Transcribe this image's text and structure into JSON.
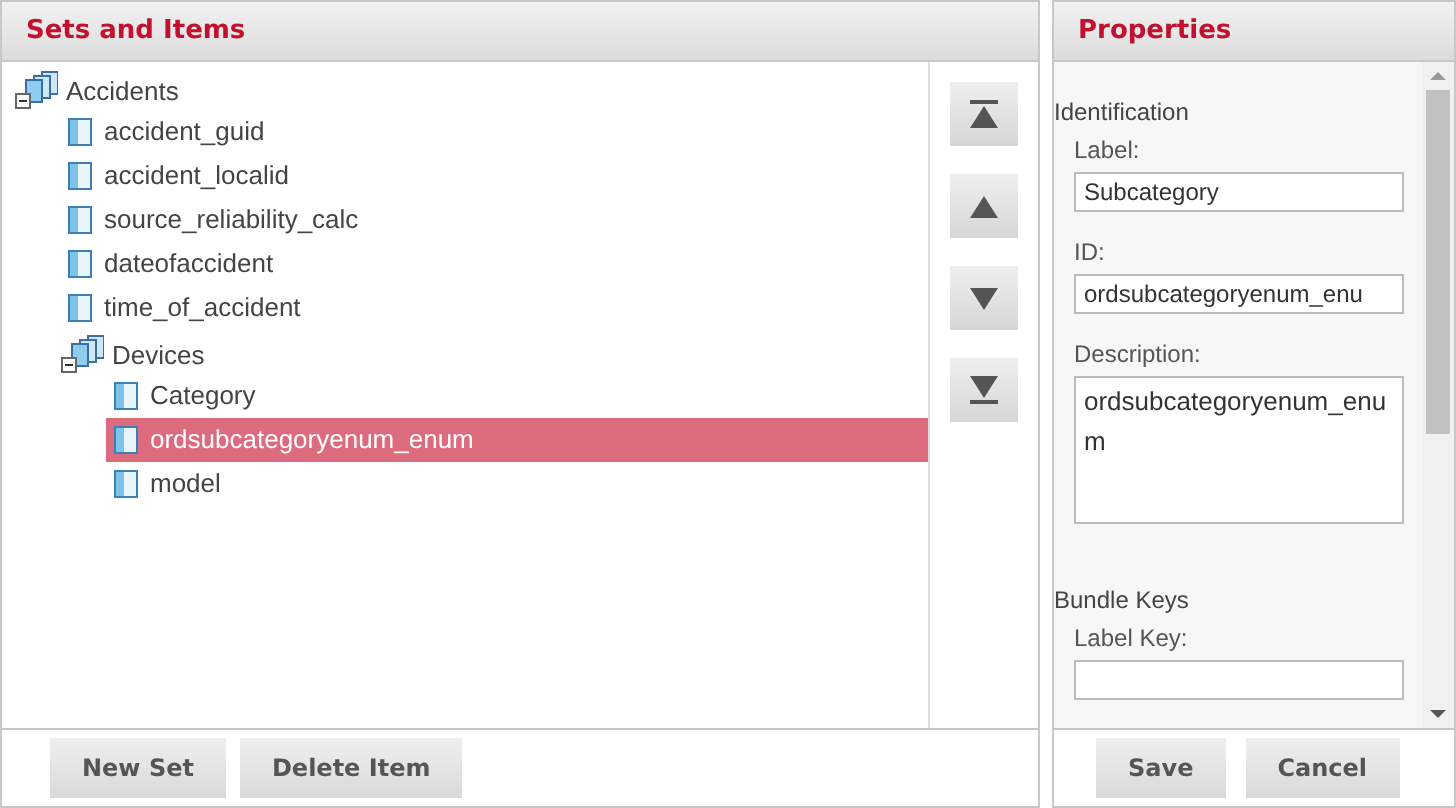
{
  "sets_panel": {
    "title": "Sets and Items",
    "tree": [
      {
        "kind": "set",
        "label": "Accidents",
        "expanded": true,
        "selected": false,
        "children": [
          {
            "kind": "item",
            "label": "accident_guid",
            "selected": false
          },
          {
            "kind": "item",
            "label": "accident_localid",
            "selected": false
          },
          {
            "kind": "item",
            "label": "source_reliability_calc",
            "selected": false
          },
          {
            "kind": "item",
            "label": "dateofaccident",
            "selected": false
          },
          {
            "kind": "item",
            "label": "time_of_accident",
            "selected": false
          },
          {
            "kind": "set",
            "label": "Devices",
            "expanded": true,
            "selected": false,
            "children": [
              {
                "kind": "item",
                "label": "Category",
                "selected": false
              },
              {
                "kind": "item",
                "label": "ordsubcategoryenum_enum",
                "selected": true
              },
              {
                "kind": "item",
                "label": "model",
                "selected": false
              }
            ]
          }
        ]
      }
    ],
    "move_buttons": [
      {
        "kind": "top"
      },
      {
        "kind": "up"
      },
      {
        "kind": "down"
      },
      {
        "kind": "bottom"
      }
    ],
    "buttons": [
      "New Set",
      "Delete Item"
    ]
  },
  "properties_panel": {
    "title": "Properties",
    "sections": [
      {
        "heading": "Identification",
        "fields": [
          {
            "kind": "input",
            "label": "Label:",
            "value": "Subcategory"
          },
          {
            "kind": "input",
            "label": "ID:",
            "value": "ordsubcategoryenum_enu"
          },
          {
            "kind": "textarea",
            "label": "Description:",
            "value": "ordsubcategoryenum_enum"
          }
        ]
      },
      {
        "heading": "Bundle Keys",
        "fields": [
          {
            "kind": "input",
            "label": "Label Key:"
          }
        ]
      }
    ],
    "buttons": [
      "Save",
      "Cancel"
    ]
  }
}
